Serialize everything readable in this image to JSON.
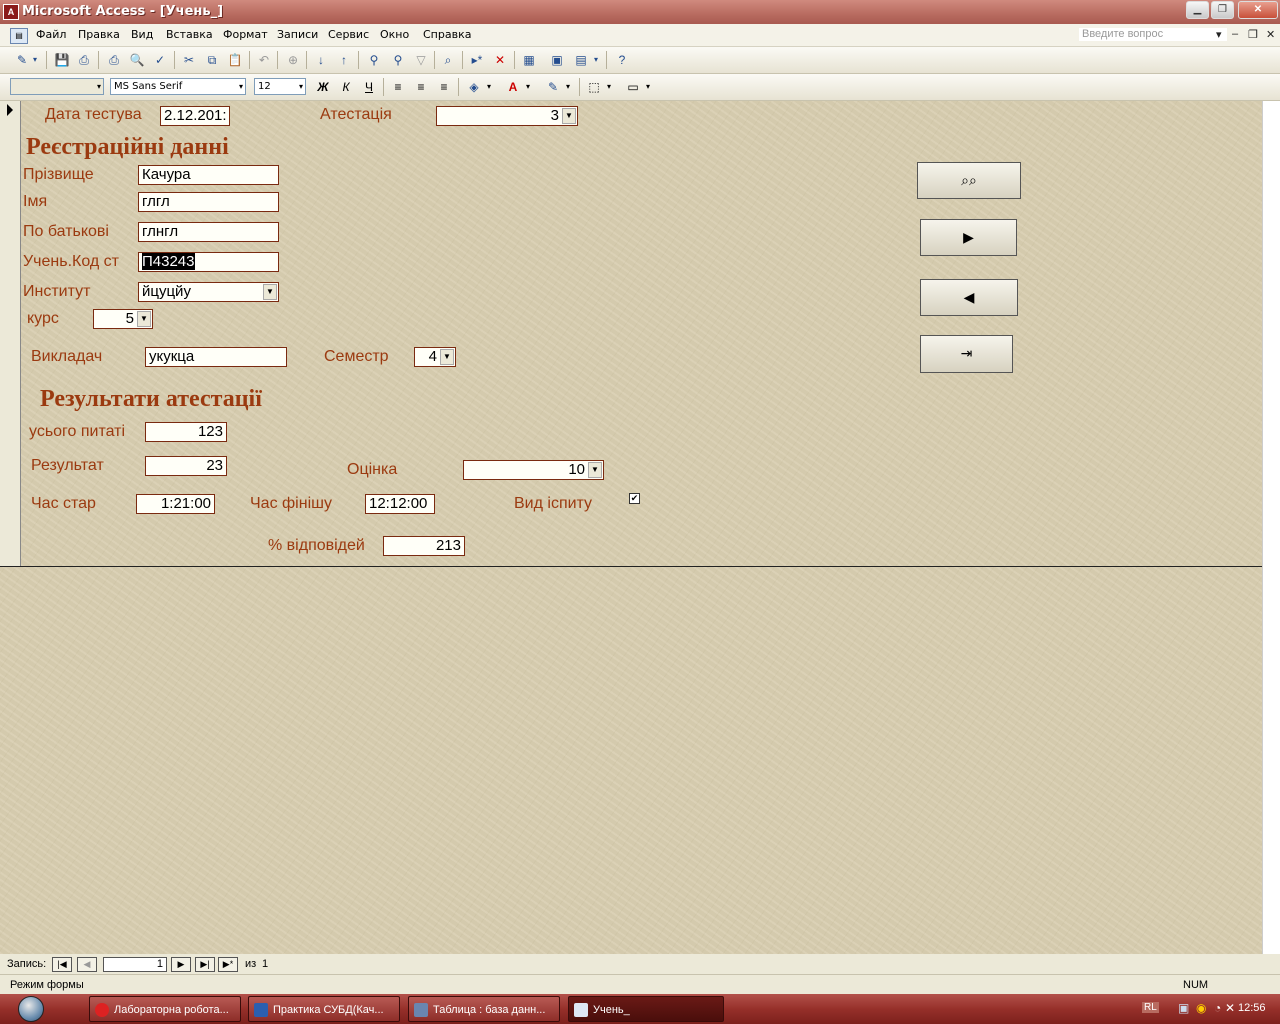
{
  "window": {
    "title": "Microsoft Access - [Учень_]",
    "app_icon_text": "A"
  },
  "menu": {
    "items": [
      "Файл",
      "Правка",
      "Вид",
      "Вставка",
      "Формат",
      "Записи",
      "Сервис",
      "Окно",
      "Справка"
    ],
    "ask_placeholder": "Введите вопрос"
  },
  "format_toolbar": {
    "font": "MS Sans Serif",
    "size": "12",
    "bold": "Ж",
    "italic": "К",
    "underline": "Ч"
  },
  "form": {
    "test_date": {
      "label": "Дата тестува",
      "value": "2.12.201:"
    },
    "attestation": {
      "label": "Атестація",
      "value": "3"
    },
    "registration_heading": "Реєстраційні данні",
    "surname": {
      "label": "Прізвище",
      "value": "Качура"
    },
    "name": {
      "label": "Імя",
      "value": "глгл"
    },
    "patronymic": {
      "label": "По батькові",
      "value": "глнгл"
    },
    "student_code": {
      "label": "Учень.Код ст",
      "value": "П43243"
    },
    "institute": {
      "label": "Институт",
      "value": "йцуцйу"
    },
    "course": {
      "label": "курс",
      "value": "5"
    },
    "teacher": {
      "label": "Викладач",
      "value": "укукца"
    },
    "semester": {
      "label": "Семестр",
      "value": "4"
    },
    "results_heading": "Результати атестації",
    "total_questions": {
      "label": "усього питаті",
      "value": "123"
    },
    "result": {
      "label": "Результат",
      "value": "23"
    },
    "grade": {
      "label": "Оцінка",
      "value": "10"
    },
    "start_time": {
      "label": "Час стар",
      "value": "1:21:00"
    },
    "finish_time": {
      "label": "Час фінішу",
      "value": "12:12:00"
    },
    "exam_type": {
      "label": "Вид іспиту",
      "checked": true
    },
    "percent": {
      "label": "% відповідей",
      "value": "213"
    }
  },
  "record_nav": {
    "label": "Запись:",
    "current": "1",
    "of": "из",
    "total": "1"
  },
  "status": {
    "mode": "Режим формы",
    "num": "NUM"
  },
  "taskbar": {
    "tasks": [
      "Лабораторна робота...",
      "Практика СУБД(Кач...",
      "Таблица : база данн...",
      "Учень_"
    ],
    "lang": "RL",
    "clock": "12:56"
  },
  "colors": {
    "label": "#9b3a10",
    "titlebar": "#b86b60",
    "taskbar": "#96302a"
  }
}
